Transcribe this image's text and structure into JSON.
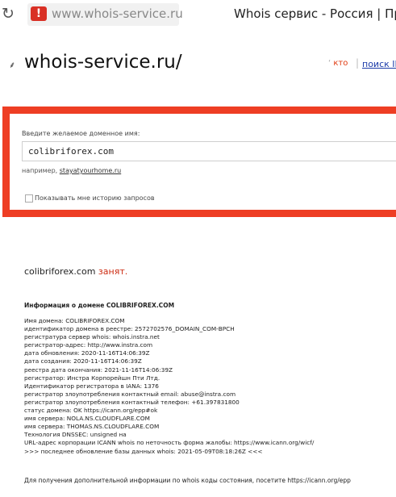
{
  "browser": {
    "url": "www.whois-service.ru",
    "tab_title": "Whois сервис - Россия | Про",
    "warning_symbol": "!"
  },
  "header": {
    "site_title": "whois-service.ru/",
    "kto_label": "кто",
    "ip_search_label": "поиск IP"
  },
  "form": {
    "prompt": "Введите желаемое доменное имя:",
    "domain_value": "colibriforex.com",
    "example_prefix": "например,",
    "example_link": "stayatyourhome.ru",
    "history_label": "Показывать мне историю запросов"
  },
  "result": {
    "domain": "colibriforex.com",
    "status": "занят.",
    "info_heading": "Информация о домене COLIBRIFOREX.COM",
    "whois_lines": [
      "Имя домена: COLIBRIFOREX.COM",
      "идентификатор домена в реестре: 2572702576_DOMAIN_COM-ВРСН",
      "регистратура сервер whois: whois.instra.net",
      "регистратор-адрес: http://www.instra.com",
      "дата обновления: 2020-11-16T14:06:39Z",
      "дата создания: 2020-11-16T14:06:39Z",
      "реестра дата окончания: 2021-11-16T14:06:39Z",
      "регистратор: Инстра Корпорейшн Пти Лтд.",
      "Идентификатор регистратора в IANA: 1376",
      "регистратор злоупотребления контактный email: abuse@instra.com",
      "регистратор злоупотребления контактный телефон: +61.397831800",
      "статус домена: OK https://icann.org/epp#ok",
      "имя сервера: NOLA.NS.CLOUDFLARE.COM",
      "имя сервера: THOMAS.NS.CLOUDFLARE.COM",
      "Технология DNSSEC: unsigned на",
      "URL-адрес корпорации ICANN whois по неточность форма жалобы: https://www.icann.org/wicf/",
      ">>> последнее обновление базы данных whois: 2021-05-09T08:18:26Z <<<"
    ],
    "footer": "Для получения дополнительной информации по whois коды состояния, посетите https://icann.org/epp"
  },
  "colors": {
    "accent_red": "#ee3e24",
    "status_red": "#cc2a10",
    "link_blue": "#1a3aa8"
  }
}
